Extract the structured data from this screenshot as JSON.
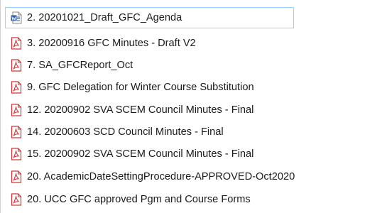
{
  "file_list": {
    "items": [
      {
        "name": "2. 20201021_Draft_GFC_Agenda",
        "icon": "word-doc-icon",
        "selected": true
      },
      {
        "name": "3. 20200916 GFC Minutes - Draft V2",
        "icon": "pdf-icon",
        "selected": false
      },
      {
        "name": "7. SA_GFCReport_Oct",
        "icon": "pdf-icon",
        "selected": false
      },
      {
        "name": "9. GFC Delegation for Winter Course Substitution",
        "icon": "pdf-icon",
        "selected": false
      },
      {
        "name": "12. 20200902 SVA SCEM Council Minutes - Final",
        "icon": "pdf-icon",
        "selected": false
      },
      {
        "name": "14. 20200603 SCD Council Minutes - Final",
        "icon": "pdf-icon",
        "selected": false
      },
      {
        "name": "15. 20200902 SVA SCEM Council Minutes - Final",
        "icon": "pdf-icon",
        "selected": false
      },
      {
        "name": "20. AcademicDateSettingProcedure-APPROVED-Oct2020",
        "icon": "pdf-icon",
        "selected": false
      },
      {
        "name": "20. UCC GFC approved Pgm and Course Forms",
        "icon": "pdf-icon",
        "selected": false
      }
    ]
  },
  "colors": {
    "pdf_red": "#d13438",
    "word_blue": "#2b579a",
    "selection_border": "#99d1ff"
  }
}
